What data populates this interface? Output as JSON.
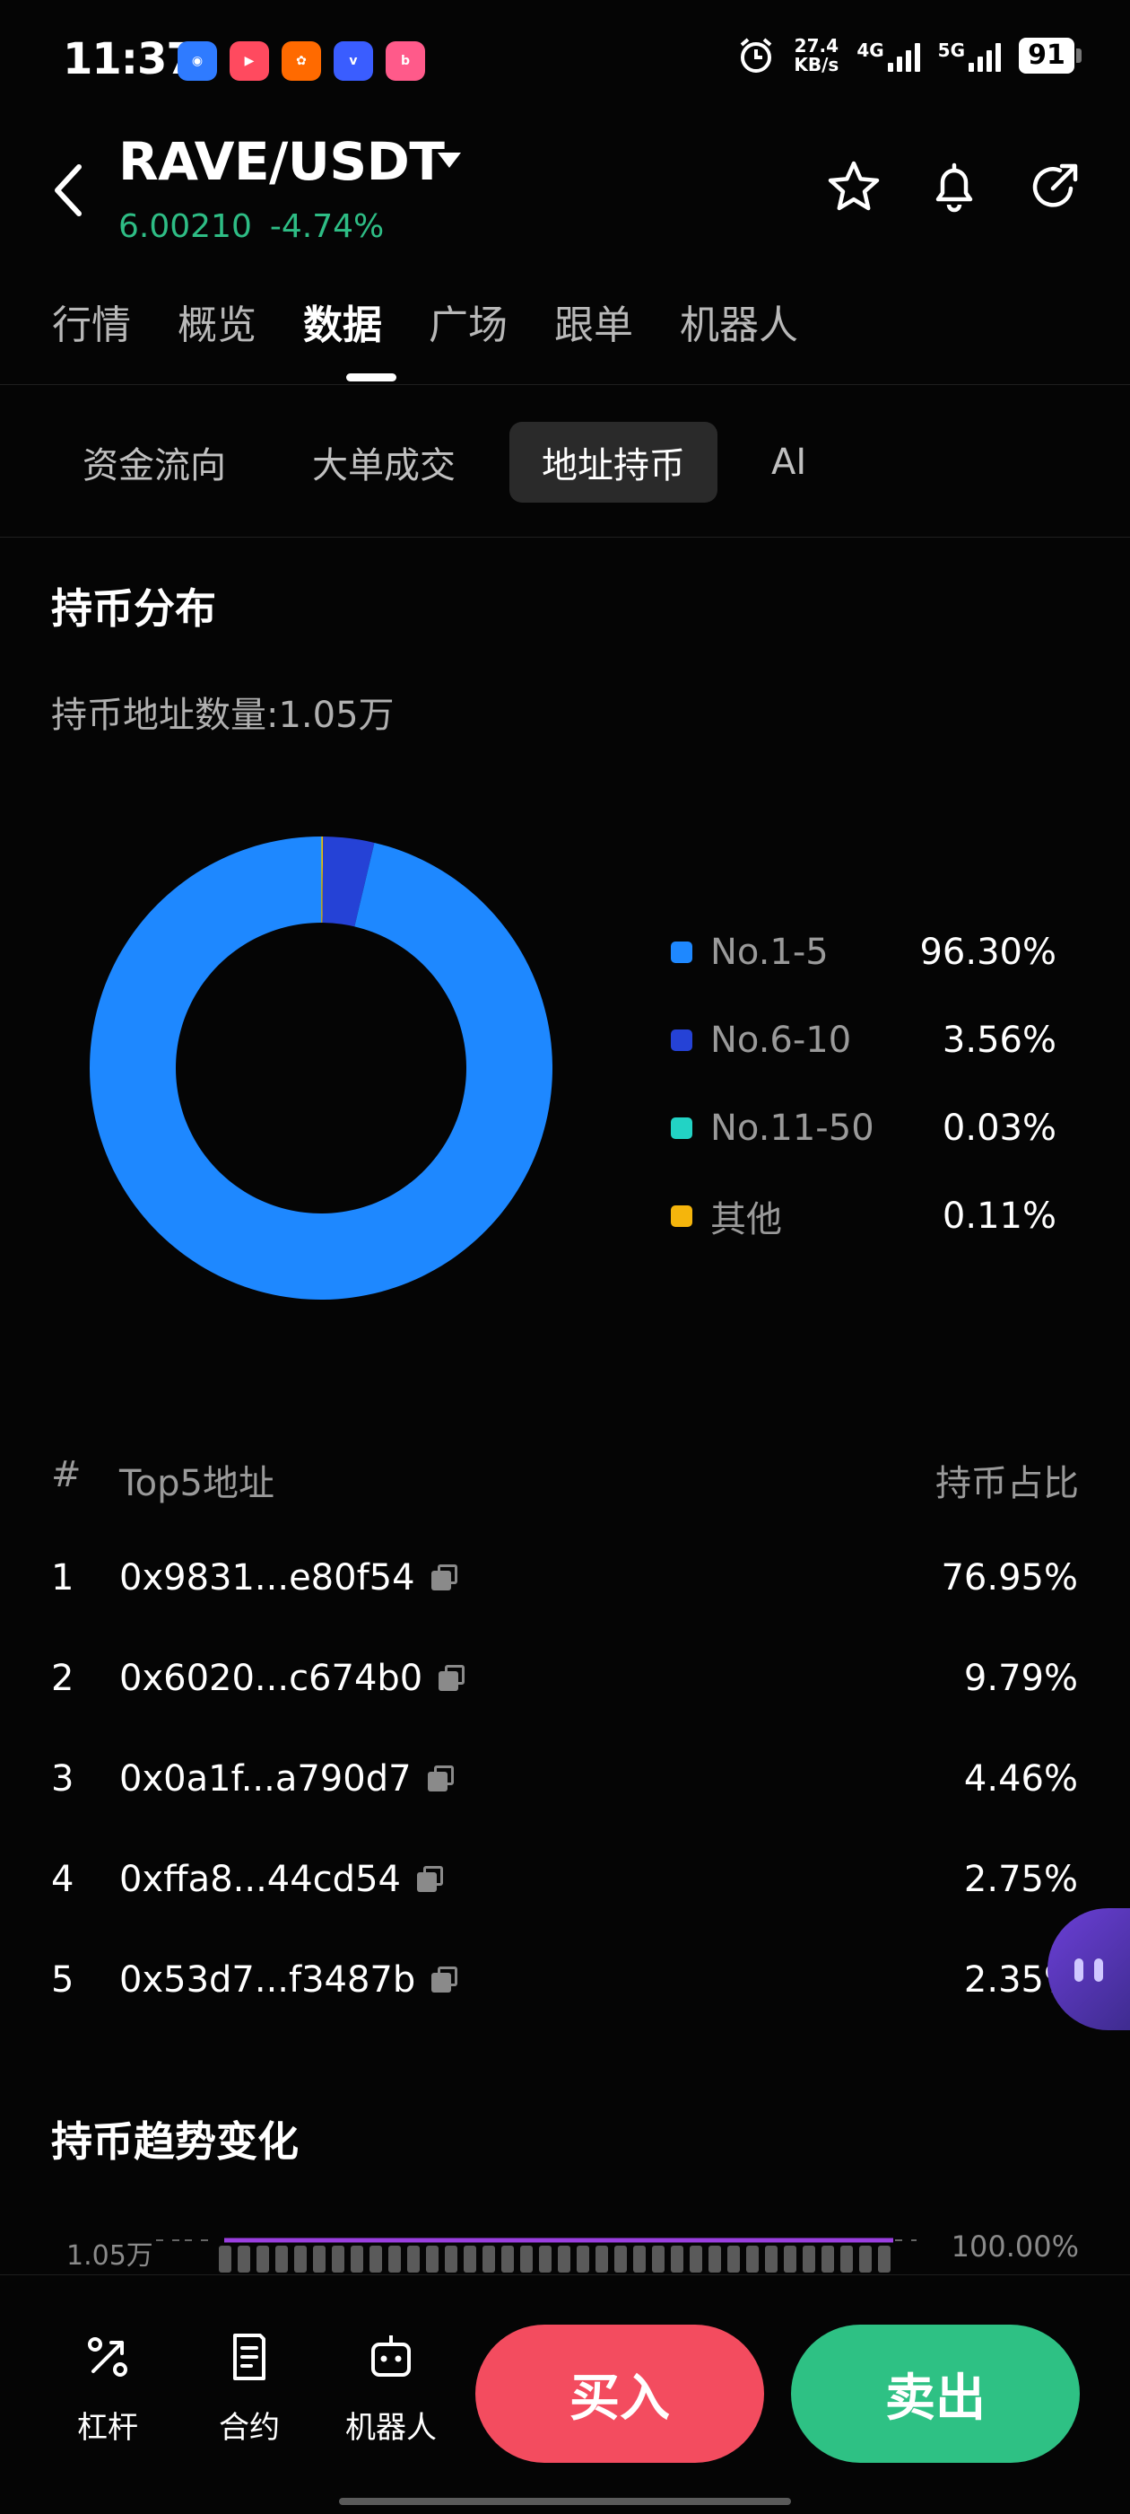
{
  "status_bar": {
    "time": "11:37",
    "speed_value": "27.4",
    "speed_unit": "KB/s",
    "net1": "4G",
    "net2": "5G",
    "battery": "91",
    "app_icons": [
      "app-icon-blue",
      "app-icon-video",
      "app-icon-kuaishou",
      "app-icon-vivo",
      "app-icon-bilibili"
    ]
  },
  "header": {
    "pair": "RAVE/USDT",
    "price": "6.00210",
    "change": "-4.74%",
    "icons": [
      "star-icon",
      "bell-icon",
      "share-icon"
    ]
  },
  "main_tabs": [
    "行情",
    "概览",
    "数据",
    "广场",
    "跟单",
    "机器人"
  ],
  "main_tab_active": "数据",
  "sub_tabs": [
    "资金流向",
    "大单成交",
    "地址持币",
    "AI"
  ],
  "sub_tab_active": "地址持币",
  "holdings": {
    "title": "持币分布",
    "address_count": "持币地址数量:1.05万"
  },
  "chart_data": {
    "type": "pie",
    "categories": [
      "No.1-5",
      "No.6-10",
      "No.11-50",
      "其他"
    ],
    "values": [
      96.3,
      3.56,
      0.03,
      0.11
    ],
    "labels": [
      "96.30%",
      "3.56%",
      "0.03%",
      "0.11%"
    ],
    "colors": [
      "#1e88ff",
      "#2542d6",
      "#22d3c5",
      "#f5b50c"
    ],
    "legend": "right"
  },
  "top5": {
    "col_index": "#",
    "col_address": "Top5地址",
    "col_share": "持币占比",
    "rows": [
      {
        "rank": "1",
        "address": "0x9831...e80f54",
        "share": "76.95%"
      },
      {
        "rank": "2",
        "address": "0x6020...c674b0",
        "share": "9.79%"
      },
      {
        "rank": "3",
        "address": "0x0a1f...a790d7",
        "share": "4.46%"
      },
      {
        "rank": "4",
        "address": "0xffa8...44cd54",
        "share": "2.75%"
      },
      {
        "rank": "5",
        "address": "0x53d7...f3487b",
        "share": "2.35%"
      }
    ]
  },
  "trend": {
    "title": "持币趋势变化",
    "left_axis_top": "1.05万",
    "right_axis_top": "100.00%"
  },
  "bottom_nav": {
    "leverage": "杠杆",
    "contract": "合约",
    "bot": "机器人",
    "buy": "买入",
    "sell": "卖出"
  }
}
